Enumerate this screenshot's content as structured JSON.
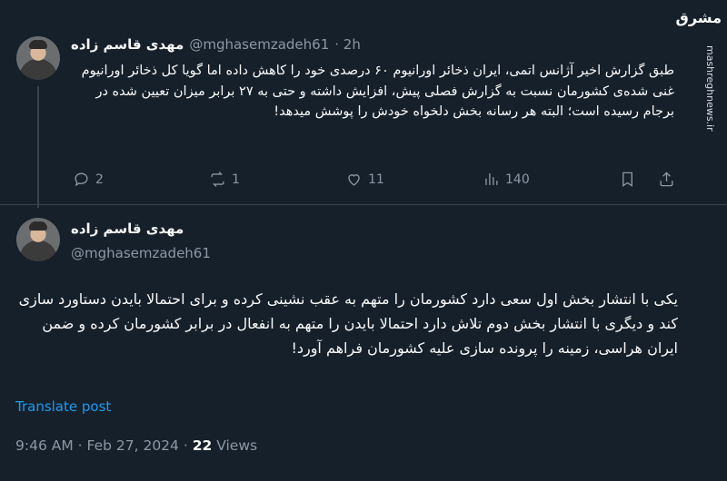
{
  "tweet1": {
    "name": "مهدی قاسم زاده",
    "handle": "@mghasemzadeh61",
    "time": "· 2h",
    "text": "طبق گزارش اخیر آژانس اتمی، ایران ذخائر اورانیوم ۶۰ درصدی خود را کاهش داده اما گویا کل ذخائر اورانیوم غنی شده‌ی کشورمان نسبت به گزارش فصلی پیش، افزایش داشته و حتی به ۲۷ برابر میزان تعیین شده در برجام رسیده است؛ البته هر رسانه بخش دلخواه خودش را پوشش میدهد!",
    "replies": "2",
    "reposts": "1",
    "likes": "11",
    "views": "140"
  },
  "tweet2": {
    "name": "مهدی قاسم زاده",
    "handle": "@mghasemzadeh61",
    "text": "یکی با انتشار بخش اول سعی دارد کشورمان را متهم به عقب نشینی کرده و برای احتمالا بایدن دستاورد سازی کند و دیگری با انتشار بخش دوم تلاش دارد احتمالا بایدن را متهم به انفعال در برابر کشورمان کرده و ضمن ایران هراسی، زمینه را پرونده سازی علیه کشورمان فراهم آورد!",
    "translate": "Translate post",
    "time": "9:46 AM",
    "date": "Feb 27, 2024",
    "views_count": "22",
    "views_label": "Views"
  },
  "watermark": {
    "logo": "مشرق",
    "url": "mashreghnews.ir"
  }
}
